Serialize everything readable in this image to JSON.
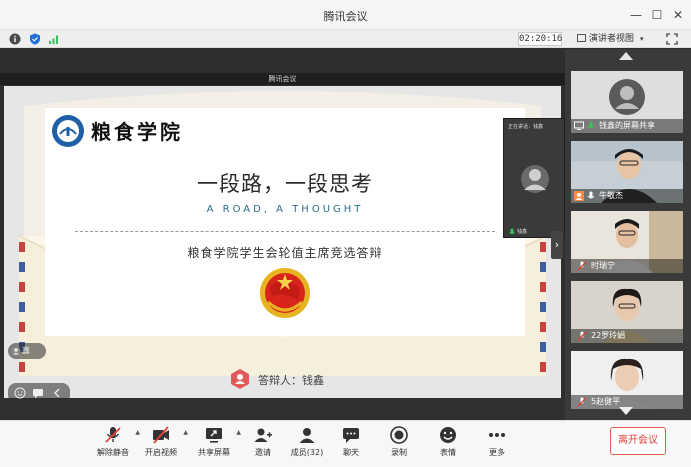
{
  "window": {
    "title": "腾讯会议",
    "minimize": "—",
    "maximize": "☐",
    "close": "✕"
  },
  "infobar": {
    "timer": "02:20:16",
    "view_label": "演讲者视图",
    "view_caret": "▾"
  },
  "share_banner": "腾讯会议",
  "slide": {
    "school": "粮食学院",
    "heading": "一段路，一段思考",
    "subheading": "A ROAD, A THOUGHT",
    "topic": "粮食学院学生会轮值主席竞选答辩",
    "respondent": "答辩人：钱鑫"
  },
  "speaker_thumb": {
    "label": "正在讲话：钱鑫",
    "name": "钱鑫"
  },
  "overlay_label": "鑫",
  "collapse_arrow": "›",
  "participants": [
    {
      "name": "钱鑫的屏幕共享"
    },
    {
      "name": "牛敬杰"
    },
    {
      "name": "时瑞宁"
    },
    {
      "name": "22罗玲娟"
    },
    {
      "name": "5赵健平"
    }
  ],
  "toolbar": {
    "items": [
      {
        "label": "解除静音",
        "icon": "mic-muted-icon"
      },
      {
        "label": "开启视频",
        "icon": "camera-off-icon"
      },
      {
        "label": "共享屏幕",
        "icon": "share-screen-icon"
      },
      {
        "label": "邀请",
        "icon": "invite-icon"
      },
      {
        "label": "成员(32)",
        "icon": "members-icon"
      },
      {
        "label": "聊天",
        "icon": "chat-icon"
      },
      {
        "label": "录制",
        "icon": "record-icon"
      },
      {
        "label": "表情",
        "icon": "emoji-icon"
      },
      {
        "label": "更多",
        "icon": "more-icon"
      }
    ],
    "caret": "▲",
    "leave_label": "离开会议"
  },
  "colors": {
    "accent_green": "#3cc05a",
    "leave_red": "#e0403a",
    "muted_red": "#e0403a",
    "link_blue": "#2c6e8a"
  }
}
